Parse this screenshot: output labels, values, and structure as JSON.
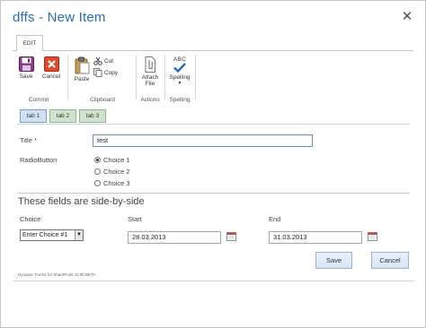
{
  "dialog": {
    "title": "dffs - New Item",
    "close": "✕"
  },
  "ribbon": {
    "tab": "EDIT",
    "groups": {
      "commit": "Commit",
      "clipboard": "Clipboard",
      "actions": "Actions",
      "spelling": "Spelling"
    },
    "buttons": {
      "save": "Save",
      "cancel": "Cancel",
      "paste": "Paste",
      "cut": "Cut",
      "copy": "Copy",
      "attach_line1": "Attach",
      "attach_line2": "File",
      "spelling": "Spelling",
      "abc": "ABC"
    }
  },
  "form_tabs": [
    "tab 1",
    "tab 2",
    "tab 3"
  ],
  "fields": {
    "title_label": "Title *",
    "title_value": "test",
    "radio_label": "RadioButton",
    "choices": [
      "Choice 1",
      "Choice 2",
      "Choice 3"
    ],
    "selected_choice": "Choice 1"
  },
  "side_section": {
    "heading": "These fields are side-by-side",
    "choice_label": "Choice",
    "choice_value": "Enter Choice #1",
    "start_label": "Start",
    "start_value": "28.03.2013",
    "end_label": "End",
    "end_value": "31.03.2013"
  },
  "actions": {
    "save": "Save",
    "cancel": "Cancel"
  },
  "footer": "Dynamic Forms for SharePoint v2.90 BETA"
}
